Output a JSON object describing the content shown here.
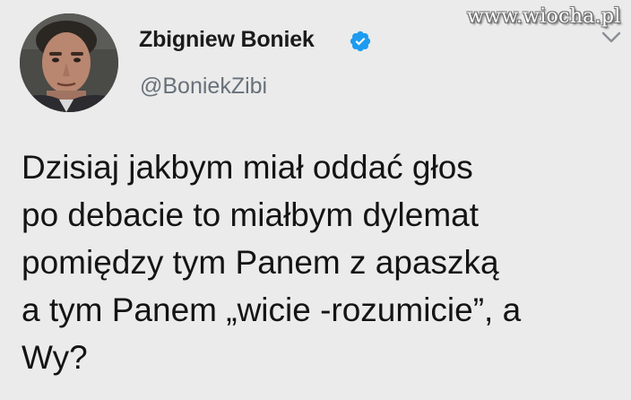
{
  "watermark": "www.wiocha.pl",
  "author": {
    "display_name": "Zbigniew Boniek",
    "handle": "@BoniekZibi",
    "verified": true
  },
  "tweet": {
    "lines": [
      "Dzisiaj jakbym miał oddać głos",
      "po debacie to miałbym dylemat",
      "pomiędzy tym Panem z apaszką",
      "a tym Panem „wicie -rozumicie”, a",
      "Wy?"
    ]
  },
  "colors": {
    "background": "#ebebeb",
    "verified_blue": "#1d9bf0",
    "handle_gray": "#68717a",
    "text": "#141414"
  },
  "icons": [
    "avatar",
    "verified-badge-icon",
    "chevron-down-icon"
  ]
}
